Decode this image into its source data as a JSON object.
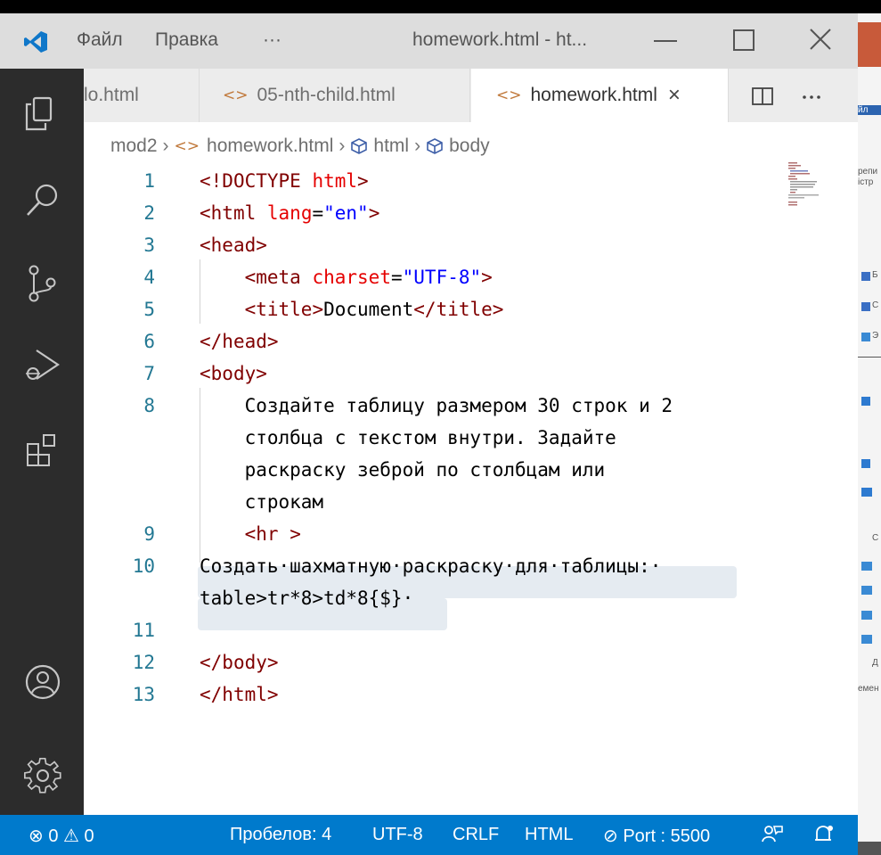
{
  "titlebar": {
    "menu": [
      "Файл",
      "Правка",
      "···"
    ],
    "title": "homework.html - ht..."
  },
  "tabs": [
    {
      "label": "lo.html",
      "icon": "html-file-icon",
      "active": false
    },
    {
      "label": "05-nth-child.html",
      "icon": "html-file-icon",
      "active": false
    },
    {
      "label": "homework.html",
      "icon": "html-file-icon",
      "active": true,
      "close": "×"
    }
  ],
  "breadcrumb": {
    "folder": "mod2",
    "file": "homework.html",
    "items": [
      "html",
      "body"
    ],
    "sep": "›"
  },
  "code_lines": [
    {
      "n": "1",
      "html": "<span class=\"t-punc\">&lt;!</span><span class=\"t-tag\">DOCTYPE</span> <span class=\"t-attr\">html</span><span class=\"t-punc\">&gt;</span>"
    },
    {
      "n": "2",
      "html": "<span class=\"t-punc\">&lt;</span><span class=\"t-tag\">html</span> <span class=\"t-attr\">lang</span>=<span class=\"t-str\">\"en\"</span><span class=\"t-punc\">&gt;</span>"
    },
    {
      "n": "3",
      "html": "<span class=\"t-punc\">&lt;</span><span class=\"t-tag\">head</span><span class=\"t-punc\">&gt;</span>"
    },
    {
      "n": "4",
      "html": "    <span class=\"t-punc\">&lt;</span><span class=\"t-tag\">meta</span> <span class=\"t-attr\">charset</span>=<span class=\"t-str\">\"UTF-8\"</span><span class=\"t-punc\">&gt;</span>"
    },
    {
      "n": "5",
      "html": "    <span class=\"t-punc\">&lt;</span><span class=\"t-tag\">title</span><span class=\"t-punc\">&gt;</span>Document<span class=\"t-punc\">&lt;/</span><span class=\"t-tag\">title</span><span class=\"t-punc\">&gt;</span>"
    },
    {
      "n": "6",
      "html": "<span class=\"t-punc\">&lt;/</span><span class=\"t-tag\">head</span><span class=\"t-punc\">&gt;</span>"
    },
    {
      "n": "7",
      "html": "<span class=\"t-punc\">&lt;</span><span class=\"t-tag\">body</span><span class=\"t-punc\">&gt;</span>"
    },
    {
      "n": "8",
      "html": "    Создайте таблицу размером 30 строк и 2"
    },
    {
      "n": "",
      "html": "    столбца с текстом внутри. Задайте"
    },
    {
      "n": "",
      "html": "    раскраску зеброй по столбцам или"
    },
    {
      "n": "",
      "html": "    строкам"
    },
    {
      "n": "9",
      "html": "    <span class=\"t-punc\">&lt;</span><span class=\"t-tag\">hr</span> <span class=\"t-punc\">&gt;</span>"
    },
    {
      "n": "10",
      "html": "Создать·шахматную·раскраску·для·таблицы:·"
    },
    {
      "n": "",
      "html": "table&gt;tr*8&gt;td*8{$}·"
    },
    {
      "n": "11",
      "html": ""
    },
    {
      "n": "12",
      "html": "<span class=\"t-punc\">&lt;/</span><span class=\"t-tag\">body</span><span class=\"t-punc\">&gt;</span>"
    },
    {
      "n": "13",
      "html": "<span class=\"t-punc\">&lt;/</span><span class=\"t-tag\">html</span><span class=\"t-punc\">&gt;</span>"
    }
  ],
  "statusbar": {
    "problems": "⊗ 0 ⚠ 0",
    "spaces": "Пробелов: 4",
    "encoding": "UTF-8",
    "eol": "CRLF",
    "language": "HTML",
    "port": "⊘ Port : 5500"
  },
  "colors": {
    "statusbar": "#007acc",
    "activitybar": "#2c2c2c",
    "titlebar": "#dddddd",
    "line_number": "#237893",
    "tag": "#800000",
    "attr": "#e50000",
    "string": "#0000ff"
  },
  "bgapp": {
    "texts": [
      "йл",
      "репи",
      "істр",
      "Б",
      "С",
      "Э",
      "С",
      "Д",
      "емен"
    ]
  }
}
